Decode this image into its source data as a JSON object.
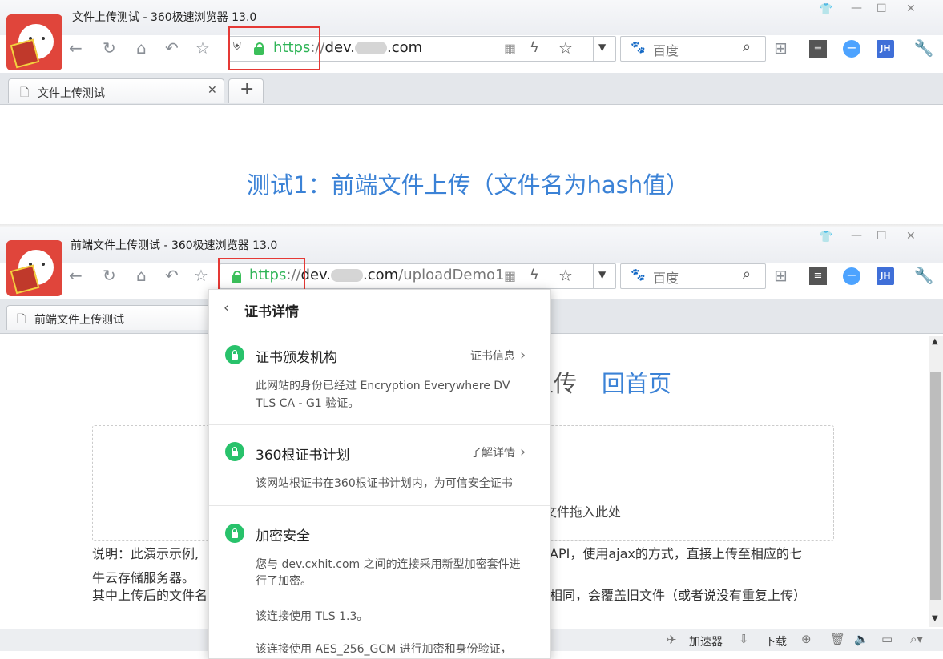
{
  "window1": {
    "title": "文件上传测试 - 360极速浏览器 13.0",
    "url_scheme": "https",
    "url_sep": "://",
    "url_host_pre": "dev.",
    "url_host_post": ".com",
    "search_placeholder": "百度",
    "tab_title": "文件上传测试",
    "new_tab": "+",
    "page_heading": "测试1：前端文件上传（文件名为hash值）",
    "jh": "JH"
  },
  "window2": {
    "title": "前端文件上传测试 - 360极速浏览器 13.0",
    "url_scheme": "https",
    "url_sep": "://",
    "url_host_pre": "dev.",
    "url_host_post": ".com",
    "url_path": "/uploadDemo1",
    "search_placeholder": "百度",
    "tab_title": "前端文件上传测试",
    "jh": "JH",
    "page": {
      "heading_tail": "上传",
      "home_link": "回首页",
      "drop_hint": "文件拖入此处",
      "desc_line1_left": "说明：此演示示例,",
      "desc_line1_right": "API，使用ajax的方式，直接上传至相应的七",
      "desc_line2": "牛云存储服务器。",
      "desc_line3_left": "其中上传后的文件名",
      "desc_line3_right": "相同，会覆盖旧文件（或者说没有重复上传）"
    },
    "status": {
      "accelerator": "加速器",
      "download": "下载"
    }
  },
  "cert_popup": {
    "title": "证书详情",
    "sections": [
      {
        "title": "证书颁发机构",
        "link": "证书信息",
        "lines": [
          "此网站的身份已经过 Encryption Everywhere DV",
          "TLS CA - G1 验证。"
        ]
      },
      {
        "title": "360根证书计划",
        "link": "了解详情",
        "lines": [
          "该网站根证书在360根证书计划内，为可信安全证书"
        ]
      },
      {
        "title": "加密安全",
        "link": "",
        "lines": [
          "您与 dev.cxhit.com 之间的连接采用新型加密套件进",
          "行了加密。",
          "",
          "该连接使用 TLS 1.3。",
          "",
          "该连接使用 AES_256_GCM 进行加密和身份验证，"
        ]
      }
    ]
  },
  "colors": {
    "accent_blue": "#3b82d6",
    "secure_green": "#2fb457",
    "highlight_red": "#e53935",
    "lock_green": "#28c26b"
  },
  "icons": [
    "back-icon",
    "refresh-icon",
    "home-icon",
    "undo-icon",
    "star-icon",
    "shield-icon",
    "lock-icon",
    "qr-icon",
    "lightning-icon",
    "favorite-icon",
    "dropdown-icon",
    "paw-icon",
    "search-icon",
    "apps-icon",
    "reader-icon",
    "minus-circle-icon",
    "jh-icon",
    "wrench-icon",
    "skin-icon",
    "minimize-icon",
    "maximize-icon",
    "close-icon",
    "page-icon",
    "chevron-left-icon",
    "chevron-right-icon"
  ]
}
